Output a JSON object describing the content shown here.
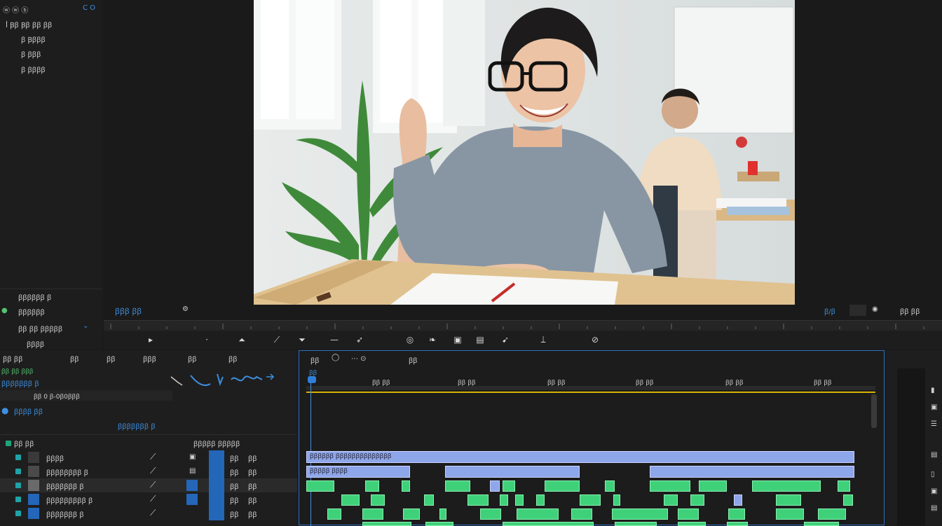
{
  "project_panel": {
    "header_left": "ⓦ ⓦ ⓑ",
    "header_right": "C O",
    "items": [
      {
        "label": "ꟾ Ꞵꞵ Ꞵꞵ ꞵꞵ ꞵꞵ"
      },
      {
        "label": "ꞵ Ꞵꞵꞵꞵ"
      },
      {
        "label": "ꞵ ꞵꞵꞵ"
      },
      {
        "label": "ꞵ ꞵꞵꞵꞵ"
      }
    ],
    "lower_items": [
      {
        "label": "ꞵꞵꞵꞵꞵꞵ ꞵ"
      },
      {
        "label": "ꞵꞵꞵꞵꞵꞵ"
      },
      {
        "label": "ꞵꞵ ꞵꞵ ꞵꞵꞵꞵꞵ"
      },
      {
        "label": "ꞵꞵꞵꞵ"
      }
    ]
  },
  "monitor": {
    "left_controls": "ꞵꞵꞵ ꞵꞵ",
    "right_controls": "ꞵ/ꞵ",
    "right_extra": "ꞵꞵ ꞵꞵ"
  },
  "tools": [
    "▸",
    "·",
    "⏶",
    "⟋",
    "⏷",
    "—",
    "➶",
    "◎",
    "❧",
    "▣",
    "▤",
    "➹",
    "⟘",
    "⊘"
  ],
  "track_panel": {
    "columns": [
      "ꞵꞵ ꞵꞵ",
      "ꞵꞵ",
      "ꞵꞵ",
      "ꞵꞵꞵ",
      "ꞵꞵ",
      "ꞵꞵ"
    ],
    "subheader_green": "ꞵꞵ ꞵꞵ ꞵꞵꞵ",
    "subheader_blue": "ꞵꞵꞵꞵꞵꞵꞵ ꞵ",
    "timecode": "ꞵꞵ 0 ꞵ-0ꞵ0ꞵꞵꞵ",
    "info_blue": "ꞵꞵꞵꞵ  ꞵꞵ",
    "info_right": "ꞵꞵꞵꞵꞵꞵꞵ ꞵ",
    "section_left": "ꞵꞵ ꞵꞵ",
    "section_mid": "ꞵꞵꞵꞵꞵ ꞵꞵꞵꞵꞵ",
    "tracks": [
      {
        "name": "ꞵꞵꞵꞵ",
        "v1": "ꞵꞵ",
        "v2": "ꞵꞵ"
      },
      {
        "name": "ꞵꞵꞵꞵꞵꞵꞵꞵ ꞵ",
        "v1": "ꞵꞵ",
        "v2": "ꞵꞵ"
      },
      {
        "name": "ꞵꞵꞵꞵꞵꞵꞵ ꞵ",
        "v1": "ꞵꞵ",
        "v2": "ꞵꞵ"
      },
      {
        "name": "ꞵꞵꞵꞵꞵꞵꞵꞵꞵ ꞵ",
        "v1": "ꞵꞵ",
        "v2": "ꞵꞵ"
      },
      {
        "name": "ꞵꞵꞵꞵꞵꞵꞵ ꞵ",
        "v1": "ꞵꞵ",
        "v2": "ꞵꞵ"
      }
    ]
  },
  "timeline": {
    "header": "ꞵꞵ",
    "header2": "ꞵꞵ",
    "playhead_label": "ꞵꞵ",
    "ruler": [
      "ꞵꞵ ꞵꞵ",
      "ꞵꞵ ꞵꞵ",
      "ꞵꞵ ꞵꞵ",
      "ꞵꞵ ꞵꞵ",
      "ꞵꞵ ꞵꞵ",
      "ꞵꞵ ꞵꞵ"
    ],
    "clip_row1_label": "ꞵꞵꞵꞵꞵꞵ  ꞵꞵꞵꞵꞵꞵꞵꞵꞵꞵꞵꞵꞵꞵ",
    "clip_row2_label": "ꞵꞵꞵꞵꞵ ꞵꞵꞵꞵ"
  },
  "colors": {
    "accent": "#2f7fd8",
    "clip_blue": "#8ea6ea",
    "clip_green": "#3fd17a",
    "playhead": "#d8b400"
  }
}
